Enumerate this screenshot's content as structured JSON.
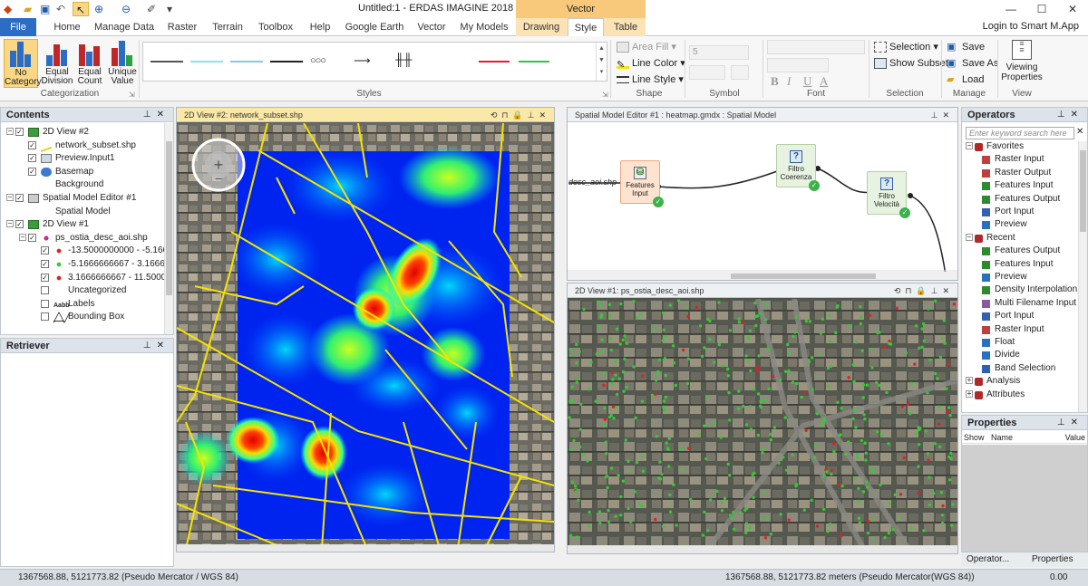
{
  "window": {
    "title": "Untitled:1 - ERDAS IMAGINE 2018",
    "contextual_tab_group": "Vector",
    "login": "Login to Smart M.App"
  },
  "tabs": [
    "File",
    "Home",
    "Manage Data",
    "Raster",
    "Terrain",
    "Toolbox",
    "Help",
    "Google Earth",
    "Vector",
    "My Models",
    "Drawing",
    "Style",
    "Table"
  ],
  "ribbon": {
    "categorization": {
      "label": "Categorization",
      "buttons": [
        "No Category",
        "Equal Division",
        "Equal Count",
        "Unique Value"
      ],
      "button_lines": [
        [
          "No",
          "Category"
        ],
        [
          "Equal",
          "Division"
        ],
        [
          "Equal",
          "Count"
        ],
        [
          "Unique",
          "Value"
        ]
      ]
    },
    "styles": {
      "label": "Styles"
    },
    "shape": {
      "label": "Shape",
      "area_fill": "Area Fill",
      "line_color": "Line Color",
      "line_style": "Line Style"
    },
    "symbol": {
      "label": "Symbol",
      "size_value": "5"
    },
    "font": {
      "label": "Font",
      "bold": "B",
      "italic": "I",
      "underline": "U",
      "color": "A"
    },
    "selection": {
      "label": "Selection",
      "selection": "Selection",
      "show_subset": "Show Subset"
    },
    "manage": {
      "label": "Manage",
      "save": "Save",
      "save_as": "Save As",
      "load": "Load"
    },
    "view": {
      "label": "View",
      "viewing_properties": "Viewing Properties",
      "viewing_lines": [
        "Viewing",
        "Properties"
      ]
    }
  },
  "contents": {
    "title": "Contents",
    "items": [
      {
        "label": "2D View #2",
        "level": 0,
        "expander": "−",
        "checked": true,
        "icon": "view-icon"
      },
      {
        "label": "network_subset.shp",
        "level": 1,
        "checked": true,
        "icon": "line-layer-icon"
      },
      {
        "label": "Preview.Input1",
        "level": 1,
        "checked": true,
        "icon": "raster-layer-icon"
      },
      {
        "label": "Basemap",
        "level": 1,
        "checked": true,
        "icon": "globe-icon"
      },
      {
        "label": "Background",
        "level": 1,
        "checked": null,
        "icon": ""
      },
      {
        "label": "Spatial Model Editor #1",
        "level": 0,
        "expander": "−",
        "checked": true,
        "icon": "model-icon"
      },
      {
        "label": "Spatial Model",
        "level": 1,
        "checked": null,
        "icon": ""
      },
      {
        "label": "2D View #1",
        "level": 0,
        "expander": "−",
        "checked": true,
        "icon": "view-icon"
      },
      {
        "label": "ps_ostia_desc_aoi.shp",
        "level": 1,
        "expander": "−",
        "checked": true,
        "icon": "point-layer-icon"
      },
      {
        "label": "-13.5000000000 - -5.1666",
        "level": 2,
        "checked": true,
        "icon": "red-dot-icon"
      },
      {
        "label": "-5.1666666667 - 3.16666",
        "level": 2,
        "checked": true,
        "icon": "green-dot-icon"
      },
      {
        "label": "3.1666666667 - 11.5000",
        "level": 2,
        "checked": true,
        "icon": "red-dot-icon"
      },
      {
        "label": "Uncategorized",
        "level": 2,
        "checked": false,
        "icon": ""
      },
      {
        "label": "Labels",
        "level": 2,
        "checked": false,
        "icon": "labels-icon"
      },
      {
        "label": "Bounding Box",
        "level": 2,
        "checked": false,
        "icon": "bbox-icon"
      }
    ]
  },
  "retriever": {
    "title": "Retriever"
  },
  "view2": {
    "title": "2D View #2: network_subset.shp"
  },
  "model_editor": {
    "title": "Spatial Model Editor #1 : heatmap.gmdx : Spatial Model",
    "port_label": "desc_aoi.shp",
    "nodes": [
      {
        "label": "Features Input",
        "lines": [
          "Features",
          "Input"
        ],
        "kind": "input"
      },
      {
        "label": "Filtro Coerenza",
        "lines": [
          "Filtro",
          "Coerenza"
        ],
        "kind": "operator"
      },
      {
        "label": "Filtro Velocità",
        "lines": [
          "Filtro",
          "Velocità"
        ],
        "kind": "operator"
      }
    ]
  },
  "view1": {
    "title": "2D View #1: ps_ostia_desc_aoi.shp"
  },
  "operators": {
    "title": "Operators",
    "search_placeholder": "Enter keyword search here",
    "items": [
      {
        "label": "Favorites",
        "level": 0,
        "expander": "−",
        "icon": "favorites-icon"
      },
      {
        "label": "Raster Input",
        "level": 1,
        "icon": "raster-icon"
      },
      {
        "label": "Raster Output",
        "level": 1,
        "icon": "raster-icon"
      },
      {
        "label": "Features Input",
        "level": 1,
        "icon": "features-icon"
      },
      {
        "label": "Features Output",
        "level": 1,
        "icon": "features-icon"
      },
      {
        "label": "Port Input",
        "level": 1,
        "icon": "port-icon"
      },
      {
        "label": "Preview",
        "level": 1,
        "icon": "preview-icon"
      },
      {
        "label": "Recent",
        "level": 0,
        "expander": "−",
        "icon": "recent-icon"
      },
      {
        "label": "Features Output",
        "level": 1,
        "icon": "features-icon"
      },
      {
        "label": "Features Input",
        "level": 1,
        "icon": "features-icon"
      },
      {
        "label": "Preview",
        "level": 1,
        "icon": "preview-icon"
      },
      {
        "label": "Density Interpolation",
        "level": 1,
        "icon": "density-icon"
      },
      {
        "label": "Multi Filename Input",
        "level": 1,
        "icon": "multi-icon"
      },
      {
        "label": "Port Input",
        "level": 1,
        "icon": "port-icon"
      },
      {
        "label": "Raster Input",
        "level": 1,
        "icon": "raster-icon"
      },
      {
        "label": "Float",
        "level": 1,
        "icon": "float-icon"
      },
      {
        "label": "Divide",
        "level": 1,
        "icon": "divide-icon"
      },
      {
        "label": "Band Selection",
        "level": 1,
        "icon": "band-icon"
      },
      {
        "label": "Analysis",
        "level": 0,
        "expander": "+",
        "icon": "analysis-icon"
      },
      {
        "label": "Attributes",
        "level": 0,
        "expander": "+",
        "icon": "attributes-icon"
      }
    ]
  },
  "properties": {
    "title": "Properties",
    "columns": [
      "Show",
      "Name",
      "Value"
    ]
  },
  "bottom_tabs": [
    "Operator...",
    "Properties"
  ],
  "status": {
    "left": "1367568.88, 5121773.82   (Pseudo Mercator / WGS 84)",
    "right": "1367568.88, 5121773.82 meters (Pseudo Mercator(WGS 84))",
    "value": "0.00"
  },
  "colors": {
    "file_tab": "#2b6cc4",
    "context_tab": "#f8c97a",
    "active_view": "#f9e8a8",
    "road": "#f5e300",
    "high_point": "#e02020",
    "low_point": "#38c838"
  }
}
